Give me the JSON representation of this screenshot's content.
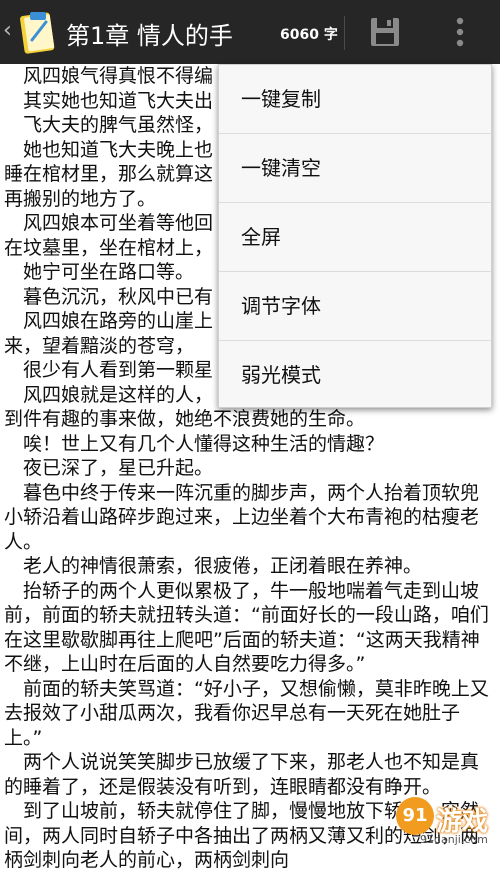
{
  "toolbar": {
    "back_glyph": "‹",
    "title": "第1章 情人的手",
    "word_count": "6060 字"
  },
  "content": {
    "paragraphs": [
      "风四娘气得真恨不得编",
      "其实她也知道飞大夫出",
      "飞大夫的脾气虽然怪，",
      "她也知道飞大夫晚上也",
      "睡在棺材里，那么就算这",
      "再搬别的地方了。",
      "风四娘本可坐着等他回",
      "在坟墓里，坐在棺材上，",
      "她宁可坐在路口等。",
      "暮色沉沉，秋风中已有",
      "风四娘在路旁的山崖上",
      "来，望着黯淡的苍穹，",
      "很少有人看到第一颗星",
      "风四娘就是这样的人，",
      "到件有趣的事来做，她绝不浪费她的生命。",
      "唉！世上又有几个人懂得这种生活的情趣？",
      "夜已深了，星已升起。",
      "暮色中终于传来一阵沉重的脚步声，两个人抬着顶软兜小轿沿着山路碎步跑过来，上边坐着个大布青袍的枯瘦老人。",
      "老人的神情很萧索，很疲倦，正闭着眼在养神。",
      "抬轿子的两个人更似累极了，牛一般地喘着气走到山坡前，前面的轿夫就扭转头道：“前面好长的一段山路，咱们在这里歇歇脚再往上爬吧”后面的轿夫道：“这两天我精神不继，上山时在后面的人自然要吃力得多。”",
      "前面的轿夫笑骂道：“好小子，又想偷懒，莫非昨晚上又去报效了小甜瓜两次，我看你迟早总有一天死在她肚子上。”",
      "两个人说说笑笑脚步已放缓了下来，那老人也不知是真的睡着了，还是假装没有听到，连眼睛都没有睁开。",
      "到了山坡前，轿夫就停住了脚，慢慢地放下轿子，突然间，两人同时自轿子中各抽出了两柄又薄又利的短剑，两柄剑刺向老人的前心，两柄剑刺向"
    ]
  },
  "menu": {
    "items": [
      {
        "label": "一键复制"
      },
      {
        "label": "一键清空"
      },
      {
        "label": "全屏"
      },
      {
        "label": "调节字体"
      },
      {
        "label": "弱光模式"
      }
    ]
  },
  "watermark": {
    "badge": "91",
    "text": "游戏",
    "url": "91danji.com"
  },
  "colors": {
    "appbar": "#262626",
    "menu_bg": "#f7f7f7",
    "watermark_orange": "#f29c1f"
  }
}
